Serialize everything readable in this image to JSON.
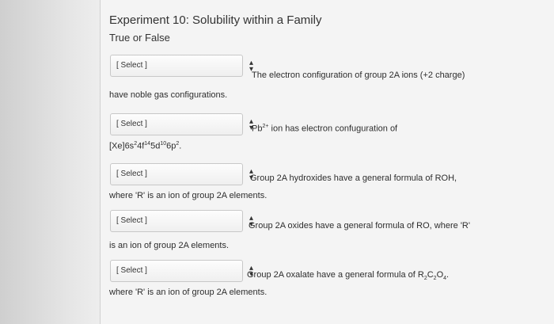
{
  "header": {
    "title": "Experiment 10: Solubility within a Family",
    "subtitle": "True or False"
  },
  "questions": [
    {
      "select_label": "[ Select ]",
      "text": "The electron configuration of group 2A ions (+2 charge)",
      "continuation": "have noble gas configurations."
    },
    {
      "select_label": "[ Select ]",
      "text_prefix": "Pb",
      "text_sup": "2+",
      "text_suffix": " ion has electron confuguration of",
      "continuation_html_parts": [
        "[Xe]6s",
        "2",
        "4f",
        "14",
        "5d",
        "10",
        "6p",
        "2",
        "."
      ]
    },
    {
      "select_label": "[ Select ]",
      "text": "Group 2A hydroxides have a general formula of ROH,",
      "continuation": "where 'R' is an ion of group 2A elements."
    },
    {
      "select_label": "[ Select ]",
      "text": "Group 2A oxides have a general formula of RO, where 'R'",
      "continuation": "is an ion of group 2A elements."
    },
    {
      "select_label": "[ Select ]",
      "text_prefix": "Group 2A oxalate have a general formula of R",
      "sub1": "2",
      "mid": "C",
      "sub2": "2",
      "mid2": "O",
      "sub3": "4",
      "text_suffix": ".",
      "continuation": "where 'R' is an ion of group 2A elements."
    }
  ]
}
